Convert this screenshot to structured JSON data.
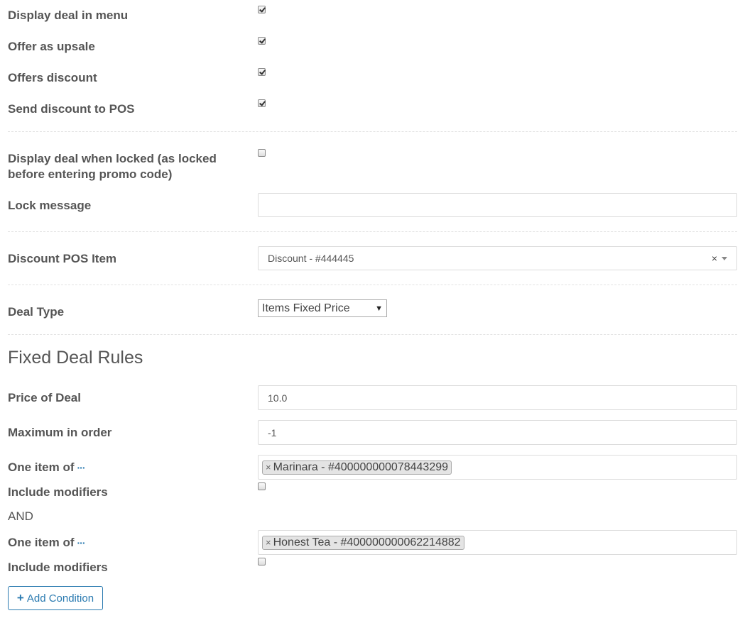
{
  "settings": {
    "display_in_menu": {
      "label": "Display deal in menu",
      "checked": true
    },
    "offer_as_upsale": {
      "label": "Offer as upsale",
      "checked": true
    },
    "offers_discount": {
      "label": "Offers discount",
      "checked": true
    },
    "send_discount_pos": {
      "label": "Send discount to POS",
      "checked": true
    }
  },
  "locked": {
    "label_line1": "Display deal when locked (as locked",
    "label_line2": "before entering promo code)",
    "checked": false,
    "lock_message_label": "Lock message",
    "lock_message_value": ""
  },
  "discount_pos_item": {
    "label": "Discount POS Item",
    "value": "Discount - #444445",
    "clear": "×"
  },
  "deal_type": {
    "label": "Deal Type",
    "selected": "Items Fixed Price",
    "arrow": "▼"
  },
  "fixed_rules": {
    "heading": "Fixed Deal Rules",
    "price_label": "Price of Deal",
    "price_value": "10.0",
    "max_label": "Maximum in order",
    "max_value": "-1"
  },
  "conditions": [
    {
      "label": "One item of",
      "more_icon": "···",
      "tag_remove": "×",
      "tag": "Marinara - #400000000078443299",
      "modifiers_label": "Include modifiers",
      "modifiers_checked": false
    },
    {
      "label": "One item of",
      "more_icon": "···",
      "tag_remove": "×",
      "tag": "Honest Tea - #400000000062214882",
      "modifiers_label": "Include modifiers",
      "modifiers_checked": false
    }
  ],
  "and_label": "AND",
  "add_condition": {
    "icon": "+",
    "label": "Add Condition"
  },
  "colors": {
    "accent": "#2a7ab0",
    "text": "#555555",
    "border": "#dcdcdc"
  }
}
